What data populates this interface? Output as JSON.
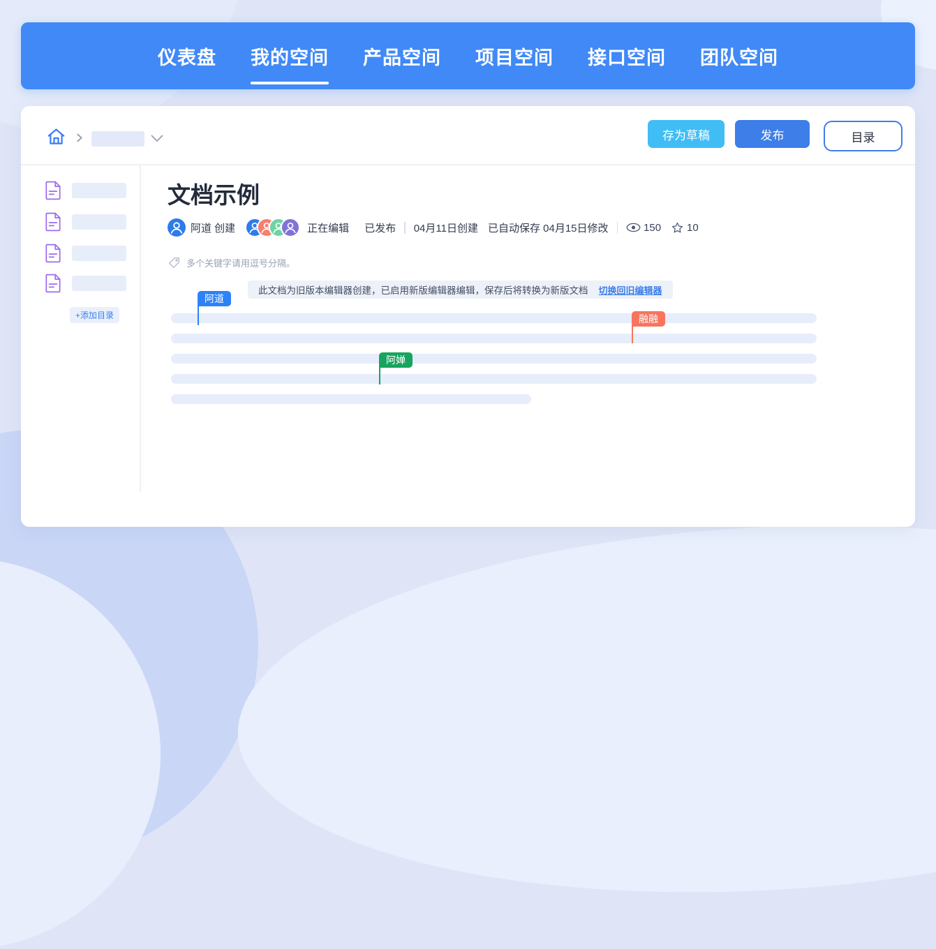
{
  "nav": {
    "items": [
      {
        "label": "仪表盘",
        "active": false
      },
      {
        "label": "我的空间",
        "active": true
      },
      {
        "label": "产品空间",
        "active": false
      },
      {
        "label": "项目空间",
        "active": false
      },
      {
        "label": "接口空间",
        "active": false
      },
      {
        "label": "团队空间",
        "active": false
      }
    ]
  },
  "toolbar": {
    "save_draft_label": "存为草稿",
    "publish_label": "发布",
    "toc_label": "目录"
  },
  "sidebar": {
    "add_toc_label": "+添加目录"
  },
  "document": {
    "title": "文档示例",
    "creator": "阿道 创建",
    "editing_label": "正在编辑",
    "publish_status": "已发布",
    "created_date": "04月11日创建",
    "modified_date": "已自动保存 04月15日修改",
    "views": "150",
    "stars": "10",
    "keywords_placeholder": "多个关键字请用逗号分隔。",
    "notice_text": "此文档为旧版本编辑器创建，已启用新版编辑器编辑，保存后将转换为新版文档",
    "notice_link": "切换回旧编辑器"
  },
  "collaborators": [
    {
      "name": "阿道",
      "color": "#2E82F7"
    },
    {
      "name": "融融",
      "color": "#F8745F"
    },
    {
      "name": "阿婵",
      "color": "#18A45E"
    }
  ],
  "editing_avatar_colors": [
    "#2E7BEA",
    "#F87E6E",
    "#6FD3A5",
    "#8172DA"
  ],
  "colors": {
    "nav_bg": "#4089F7",
    "accent_blue": "#3D7EE8",
    "save_draft_bg": "#41BDF5",
    "placeholder_bar": "#E7EDFA",
    "doc_icon_purple": "#9B6BEB",
    "page_bg": "#DFE5F7"
  }
}
